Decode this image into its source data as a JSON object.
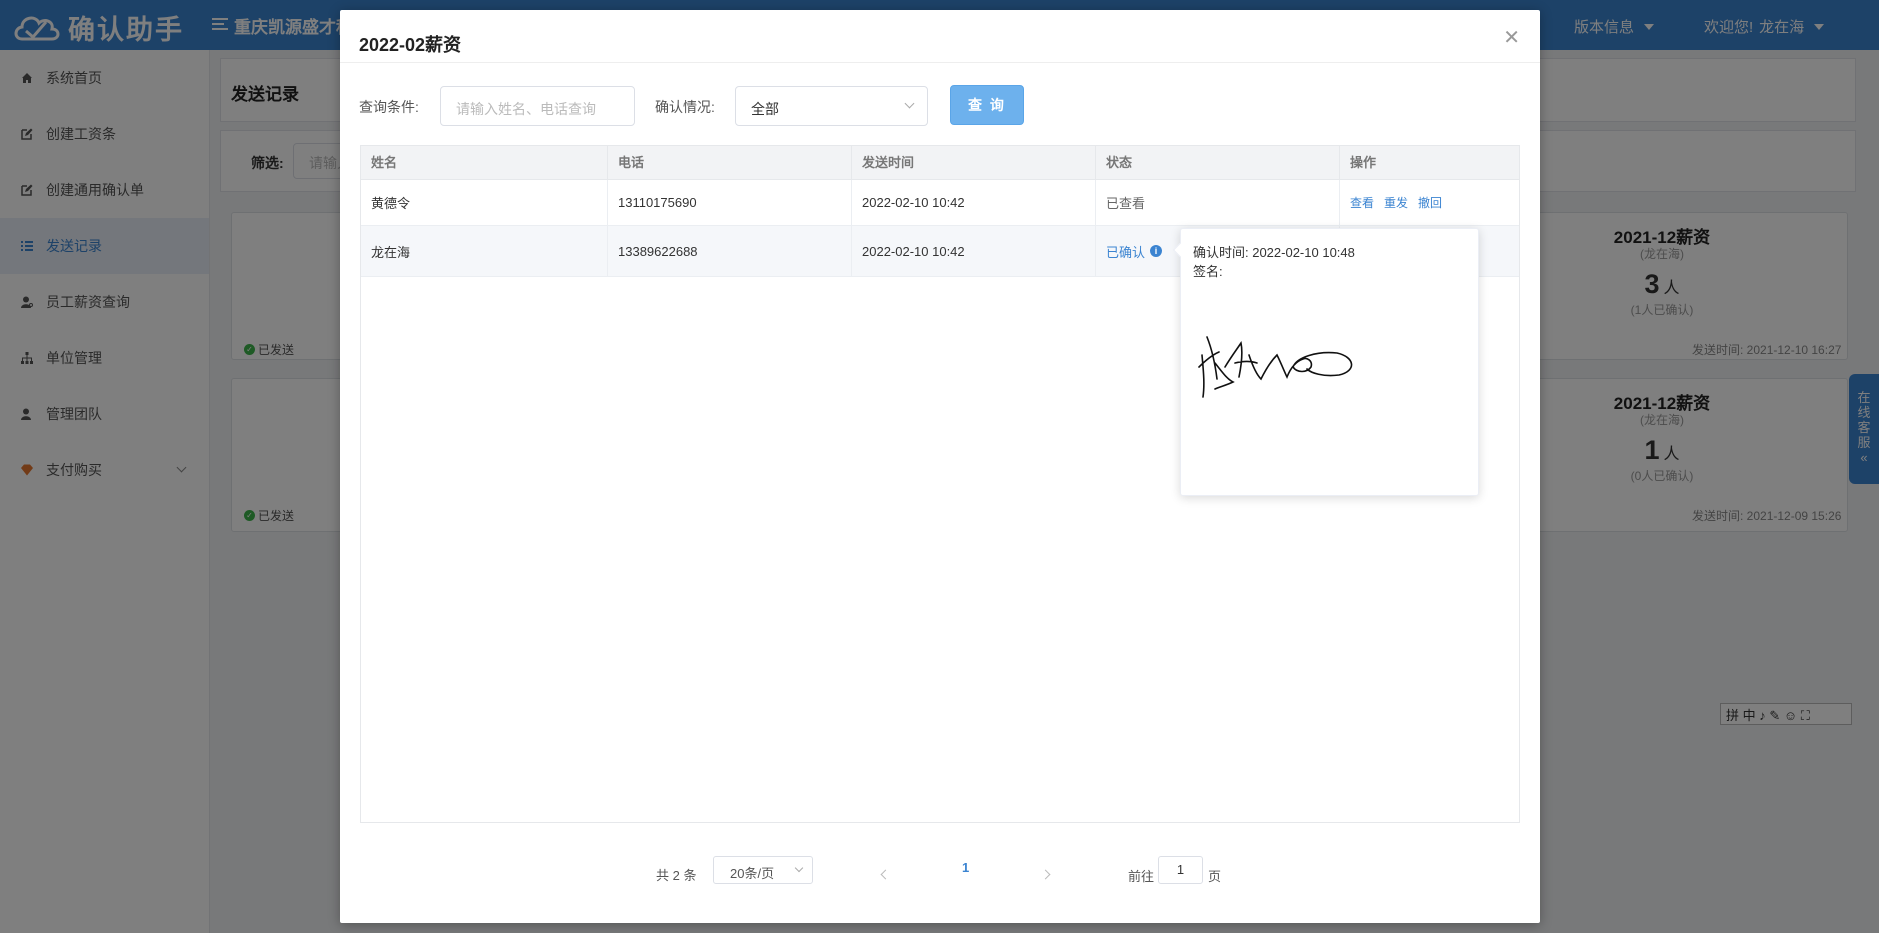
{
  "app": {
    "logo_text": "确认助手",
    "company": "重庆凯源盛才科",
    "version_label": "版本信息",
    "welcome": "欢迎您!",
    "user": "龙在海"
  },
  "sidebar": {
    "items": [
      {
        "label": "系统首页",
        "icon": "home-icon"
      },
      {
        "label": "创建工资条",
        "icon": "edit-icon"
      },
      {
        "label": "创建通用确认单",
        "icon": "edit-icon"
      },
      {
        "label": "发送记录",
        "icon": "list-icon"
      },
      {
        "label": "员工薪资查询",
        "icon": "user-search-icon"
      },
      {
        "label": "单位管理",
        "icon": "org-icon"
      },
      {
        "label": "管理团队",
        "icon": "team-icon"
      },
      {
        "label": "支付购买",
        "icon": "diamond-icon"
      }
    ]
  },
  "background": {
    "title": "发送记录",
    "filter_label": "筛选:",
    "filter_placeholder": "请输入",
    "cards": [
      {
        "status": "已发送",
        "title": "2021-12薪资",
        "sub": "(龙在海)",
        "count": "3",
        "unit": "人",
        "confirmed": "(1人已确认)",
        "time": "发送时间: 2021-12-10 16:27"
      },
      {
        "status": "已发送",
        "title": "2021-12薪资",
        "sub": "(龙在海)",
        "count": "1",
        "unit": "人",
        "confirmed": "(0人已确认)",
        "time": "发送时间: 2021-12-09 15:26"
      }
    ],
    "chat_tab": "在线客服",
    "ime_toolbar": "拼 中 ♪ ✎ ☺ ⛶"
  },
  "dialog": {
    "title": "2022-02薪资",
    "query_label": "查询条件:",
    "query_placeholder": "请输入姓名、电话查询",
    "confirm_label": "确认情况:",
    "confirm_value": "全部",
    "query_button": "查 询",
    "columns": [
      "姓名",
      "电话",
      "发送时间",
      "状态",
      "操作"
    ],
    "rows": [
      {
        "name": "黄德令",
        "phone": "13110175690",
        "time": "2022-02-10 10:42",
        "status": "已查看",
        "actions": [
          "查看",
          "重发",
          "撤回"
        ]
      },
      {
        "name": "龙在海",
        "phone": "13389622688",
        "time": "2022-02-10 10:42",
        "status": "已确认",
        "actions": []
      }
    ],
    "popover": {
      "confirm_time": "确认时间: 2022-02-10 10:48",
      "signature_label": "签名:",
      "signature_text": "龙在海"
    },
    "pagination": {
      "total": "共 2 条",
      "page_size": "20条/页",
      "current_page": "1",
      "goto_label": "前往",
      "goto_value": "1",
      "page_suffix": "页"
    }
  }
}
